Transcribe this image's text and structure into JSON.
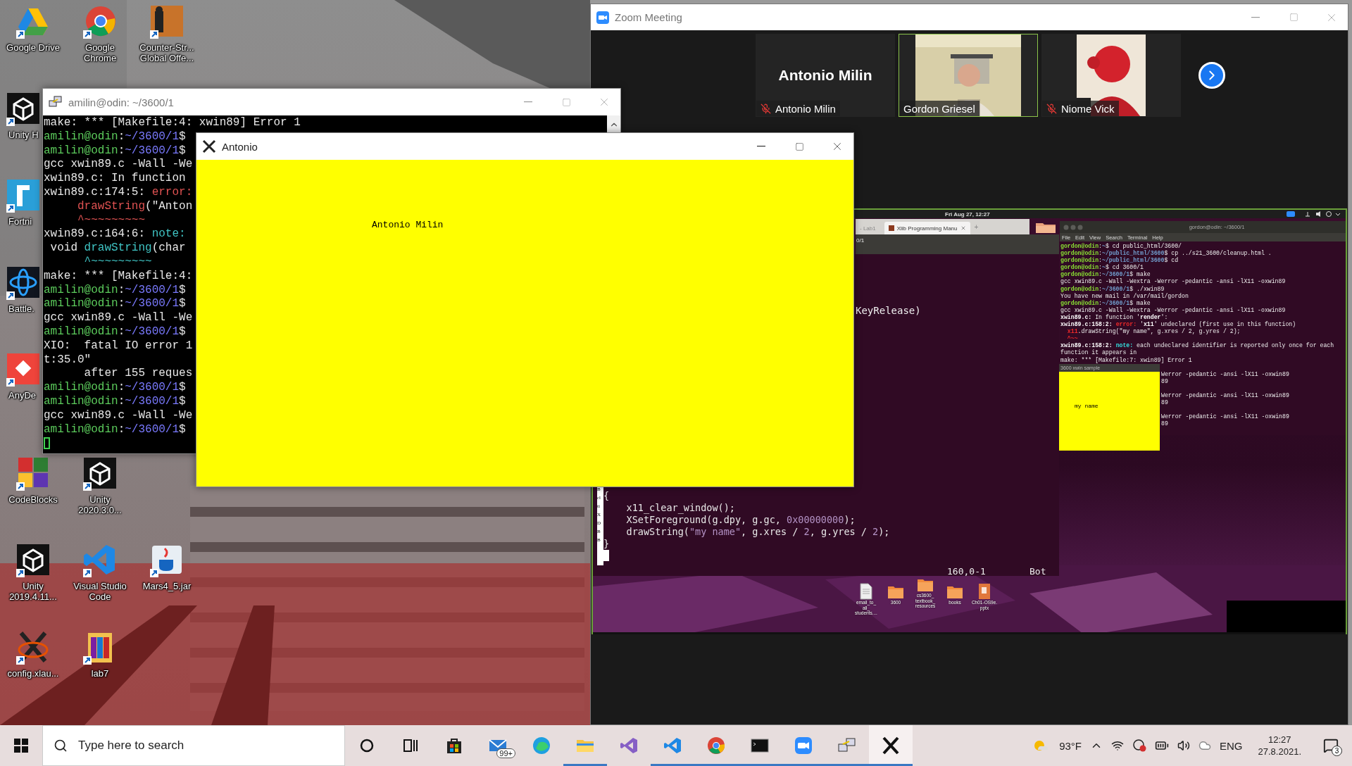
{
  "desktop_icons": [
    {
      "kind": "drive",
      "lines": [
        "Google Drive"
      ]
    },
    {
      "kind": "chrome",
      "lines": [
        "Google",
        "Chrome"
      ]
    },
    {
      "kind": "game",
      "lines": [
        "Counter-Str...",
        "Global Offe..."
      ]
    },
    {
      "kind": "unity",
      "lines": [
        "Unity H"
      ]
    },
    {
      "kind": "fortnite",
      "lines": [
        "Fortni"
      ]
    },
    {
      "kind": "battle",
      "lines": [
        "Battle."
      ]
    },
    {
      "kind": "anydesk",
      "lines": [
        "AnyDe"
      ]
    },
    {
      "kind": "codeblocks",
      "lines": [
        "CodeBlocks"
      ]
    },
    {
      "kind": "unity",
      "lines": [
        "Unity",
        "2020.3.0..."
      ]
    },
    {
      "kind": "unity",
      "lines": [
        "Unity",
        "2019.4.11..."
      ]
    },
    {
      "kind": "vscode",
      "lines": [
        "Visual Studio",
        "Code"
      ]
    },
    {
      "kind": "java",
      "lines": [
        "Mars4_5.jar"
      ]
    },
    {
      "kind": "xlaunch",
      "lines": [
        "config.xlau..."
      ]
    },
    {
      "kind": "archive",
      "lines": [
        "lab7"
      ]
    }
  ],
  "terminal": {
    "title": "amilin@odin: ~/3600/1",
    "lines": [
      [
        {
          "text": "make: *** [Makefile:4: xwin89] Error 1",
          "kind": "plain"
        }
      ],
      [
        {
          "text": "amilin@odin",
          "kind": "user"
        },
        {
          "text": ":",
          "kind": "plain"
        },
        {
          "text": "~/3600/1",
          "kind": "path"
        },
        {
          "text": "$",
          "kind": "plain"
        }
      ],
      [
        {
          "text": "amilin@odin",
          "kind": "user"
        },
        {
          "text": ":",
          "kind": "plain"
        },
        {
          "text": "~/3600/1",
          "kind": "path"
        },
        {
          "text": "$",
          "kind": "plain"
        }
      ],
      [
        {
          "text": "gcc xwin89.c -Wall -We",
          "kind": "plain"
        }
      ],
      [
        {
          "text": "xwin89.c: In function",
          "kind": "plain"
        }
      ],
      [
        {
          "text": "xwin89.c:174:5: ",
          "kind": "plain"
        },
        {
          "text": "error:",
          "kind": "error"
        }
      ],
      [
        {
          "text": "     drawString",
          "kind": "error"
        },
        {
          "text": "(\"Anton",
          "kind": "plain"
        }
      ],
      [
        {
          "text": "     ^~~~~~~~~~",
          "kind": "error"
        }
      ],
      [
        {
          "text": "xwin89.c:164:6: ",
          "kind": "plain"
        },
        {
          "text": "note:",
          "kind": "note"
        }
      ],
      [
        {
          "text": " void ",
          "kind": "plain"
        },
        {
          "text": "drawString",
          "kind": "note"
        },
        {
          "text": "(char",
          "kind": "plain"
        }
      ],
      [
        {
          "text": "      ^~~~~~~~~~",
          "kind": "note"
        }
      ],
      [
        {
          "text": "make: *** [Makefile:4:",
          "kind": "plain"
        }
      ],
      [
        {
          "text": "amilin@odin",
          "kind": "user"
        },
        {
          "text": ":",
          "kind": "plain"
        },
        {
          "text": "~/3600/1",
          "kind": "path"
        },
        {
          "text": "$",
          "kind": "plain"
        }
      ],
      [
        {
          "text": "amilin@odin",
          "kind": "user"
        },
        {
          "text": ":",
          "kind": "plain"
        },
        {
          "text": "~/3600/1",
          "kind": "path"
        },
        {
          "text": "$",
          "kind": "plain"
        }
      ],
      [
        {
          "text": "gcc xwin89.c -Wall -We",
          "kind": "plain"
        }
      ],
      [
        {
          "text": "amilin@odin",
          "kind": "user"
        },
        {
          "text": ":",
          "kind": "plain"
        },
        {
          "text": "~/3600/1",
          "kind": "path"
        },
        {
          "text": "$",
          "kind": "plain"
        }
      ],
      [
        {
          "text": "XIO:  fatal IO error 1",
          "kind": "plain"
        }
      ],
      [
        {
          "text": "t:35.0\"",
          "kind": "plain"
        }
      ],
      [
        {
          "text": "      after 155 reques",
          "kind": "plain"
        }
      ],
      [
        {
          "text": "amilin@odin",
          "kind": "user"
        },
        {
          "text": ":",
          "kind": "plain"
        },
        {
          "text": "~/3600/1",
          "kind": "path"
        },
        {
          "text": "$",
          "kind": "plain"
        }
      ],
      [
        {
          "text": "amilin@odin",
          "kind": "user"
        },
        {
          "text": ":",
          "kind": "plain"
        },
        {
          "text": "~/3600/1",
          "kind": "path"
        },
        {
          "text": "$",
          "kind": "plain"
        }
      ],
      [
        {
          "text": "gcc xwin89.c -Wall -We",
          "kind": "plain"
        }
      ],
      [
        {
          "text": "amilin@odin",
          "kind": "user"
        },
        {
          "text": ":",
          "kind": "plain"
        },
        {
          "text": "~/3600/1",
          "kind": "path"
        },
        {
          "text": "$",
          "kind": "plain"
        }
      ]
    ]
  },
  "x_window": {
    "title": "Antonio",
    "text": "Antonio Milin"
  },
  "zoom": {
    "title": "Zoom Meeting",
    "participants": [
      {
        "name": "Antonio Milin",
        "display_name": "Antonio Milin",
        "camera": false,
        "muted": true,
        "speaking": false
      },
      {
        "name": "Gordon Griesel",
        "camera": true,
        "muted": false,
        "speaking": true
      },
      {
        "name": "Niome Vick",
        "camera": true,
        "muted": true,
        "speaking": false
      }
    ],
    "shared_screen": {
      "clock": "Fri Aug 27, 12:27",
      "browser_tabs": [
        {
          "label": "- Lab1",
          "selected": false
        },
        {
          "label": "Xlib Programming Manu",
          "selected": true
        }
      ],
      "new_tab": "+",
      "editor_title": "0/1",
      "editor_line": "KeyRelease)",
      "browser_fragments": [
        "B",
        "cl",
        "ti",
        "X",
        "D",
        "B",
        "B"
      ],
      "code_lines": [
        [
          {
            "text": "{",
            "kind": "plain"
          }
        ],
        [
          {
            "text": "    x11_clear_window();",
            "kind": "plain"
          }
        ],
        [
          {
            "text": "    XSetForeground(g.dpy, g.gc, ",
            "kind": "plain"
          },
          {
            "text": "0x00000000",
            "kind": "literal"
          },
          {
            "text": ");",
            "kind": "plain"
          }
        ],
        [
          {
            "text": "    drawString(",
            "kind": "plain"
          },
          {
            "text": "\"my name\"",
            "kind": "literal"
          },
          {
            "text": ", g.xres / ",
            "kind": "plain"
          },
          {
            "text": "2",
            "kind": "literal"
          },
          {
            "text": ", g.yres / ",
            "kind": "plain"
          },
          {
            "text": "2",
            "kind": "literal"
          },
          {
            "text": ");",
            "kind": "plain"
          }
        ],
        [
          {
            "text": "}",
            "kind": "plain"
          }
        ]
      ],
      "editor_status": {
        "position": "160,0-1",
        "scroll": "Bot"
      },
      "terminal": {
        "title": "gordon@odin: ~/3600/1",
        "menu": [
          "File",
          "Edit",
          "View",
          "Search",
          "Terminal",
          "Help"
        ],
        "lines": [
          [
            {
              "text": "gordon@odin",
              "kind": "user"
            },
            {
              "text": ":",
              "kind": "plain"
            },
            {
              "text": "~",
              "kind": "path"
            },
            {
              "text": "$ cd public_html/3600/",
              "kind": "plain"
            }
          ],
          [
            {
              "text": "gordon@odin",
              "kind": "user"
            },
            {
              "text": ":",
              "kind": "plain"
            },
            {
              "text": "~/public_html/3600",
              "kind": "path"
            },
            {
              "text": "$ cp ../s21_3600/cleanup.html .",
              "kind": "plain"
            }
          ],
          [
            {
              "text": "gordon@odin",
              "kind": "user"
            },
            {
              "text": ":",
              "kind": "plain"
            },
            {
              "text": "~/public_html/3600",
              "kind": "path"
            },
            {
              "text": "$ cd",
              "kind": "plain"
            }
          ],
          [
            {
              "text": "gordon@odin",
              "kind": "user"
            },
            {
              "text": ":",
              "kind": "plain"
            },
            {
              "text": "~",
              "kind": "path"
            },
            {
              "text": "$ cd 3600/1",
              "kind": "plain"
            }
          ],
          [
            {
              "text": "gordon@odin",
              "kind": "user"
            },
            {
              "text": ":",
              "kind": "plain"
            },
            {
              "text": "~/3600/1",
              "kind": "path"
            },
            {
              "text": "$ make",
              "kind": "plain"
            }
          ],
          [
            {
              "text": "gcc xwin89.c -Wall -Wextra -Werror -pedantic -ansi -lX11 -oxwin89",
              "kind": "plain"
            }
          ],
          [
            {
              "text": "gordon@odin",
              "kind": "user"
            },
            {
              "text": ":",
              "kind": "plain"
            },
            {
              "text": "~/3600/1",
              "kind": "path"
            },
            {
              "text": "$ ./xwin89",
              "kind": "plain"
            }
          ],
          [
            {
              "text": "You have new mail in /var/mail/gordon",
              "kind": "plain"
            }
          ],
          [
            {
              "text": "gordon@odin",
              "kind": "user"
            },
            {
              "text": ":",
              "kind": "plain"
            },
            {
              "text": "~/3600/1",
              "kind": "path"
            },
            {
              "text": "$ make",
              "kind": "plain"
            }
          ],
          [
            {
              "text": "gcc xwin89.c -Wall -Wextra -Werror -pedantic -ansi -lX11 -oxwin89",
              "kind": "plain"
            }
          ],
          [
            {
              "text": "xwin89.c:",
              "kind": "bold"
            },
            {
              "text": " In function '",
              "kind": "plain"
            },
            {
              "text": "render",
              "kind": "bold"
            },
            {
              "text": "':",
              "kind": "plain"
            }
          ],
          [
            {
              "text": "xwin89.c:158:2: ",
              "kind": "bold"
            },
            {
              "text": "error: ",
              "kind": "error"
            },
            {
              "text": "'",
              "kind": "plain"
            },
            {
              "text": "x11",
              "kind": "bold"
            },
            {
              "text": "' undeclared (first use in this function)",
              "kind": "plain"
            }
          ],
          [
            {
              "text": "  x11",
              "kind": "error"
            },
            {
              "text": ".drawString(\"my name\", g.xres / 2, g.yres / 2);",
              "kind": "plain"
            }
          ],
          [
            {
              "text": "  ^~~",
              "kind": "error"
            }
          ],
          [
            {
              "text": "xwin89.c:158:2: ",
              "kind": "bold"
            },
            {
              "text": "note: ",
              "kind": "note"
            },
            {
              "text": "each undeclared identifier is reported only once for each",
              "kind": "plain"
            }
          ],
          [
            {
              "text": "function it appears in",
              "kind": "plain"
            }
          ],
          [
            {
              "text": "make: *** [Makefile:7: xwin89] Error 1",
              "kind": "plain"
            }
          ]
        ],
        "covered_lines": [
          [
            "Werror -pedantic -ansi -lX11 -oxwin89",
            "89"
          ],
          [
            "Werror -pedantic -ansi -lX11 -oxwin89",
            "89"
          ],
          [
            "Werror -pedantic -ansi -lX11 -oxwin89",
            "89"
          ]
        ]
      },
      "sample_window": {
        "title": "3600 xwin sample",
        "text": "my name"
      },
      "files": [
        {
          "kind": "document",
          "lines": [
            "email_to_",
            "all_",
            "students...."
          ]
        },
        {
          "kind": "folder",
          "lines": [
            "3600"
          ]
        },
        {
          "kind": "folder",
          "lines": [
            "cs3600_",
            "textbook_",
            "resources"
          ]
        },
        {
          "kind": "folder",
          "lines": [
            "books"
          ]
        },
        {
          "kind": "slides",
          "lines": [
            "Ch01-OS9e.",
            "pptx"
          ]
        }
      ]
    }
  },
  "taskbar": {
    "search_placeholder": "Type here to search",
    "apps": [
      {
        "kind": "cortana",
        "running": false,
        "selected": false
      },
      {
        "kind": "taskview",
        "running": false,
        "selected": false
      },
      {
        "kind": "store",
        "running": false,
        "selected": false
      },
      {
        "kind": "mail",
        "badge": "99+",
        "running": false,
        "selected": false
      },
      {
        "kind": "edge",
        "running": false,
        "selected": false
      },
      {
        "kind": "explorer",
        "running": true,
        "selected": false
      },
      {
        "kind": "visualstudio",
        "running": false,
        "selected": false
      },
      {
        "kind": "vscode",
        "running": true,
        "selected": false
      },
      {
        "kind": "chrome",
        "running": true,
        "selected": false
      },
      {
        "kind": "terminal",
        "running": true,
        "selected": false
      },
      {
        "kind": "zoom",
        "running": true,
        "selected": false
      },
      {
        "kind": "putty",
        "running": true,
        "selected": false
      },
      {
        "kind": "xserver",
        "running": true,
        "selected": true
      }
    ],
    "weather": "93°F",
    "language": "ENG",
    "time": "12:27",
    "date": "27.8.2021.",
    "notifications": "3"
  }
}
